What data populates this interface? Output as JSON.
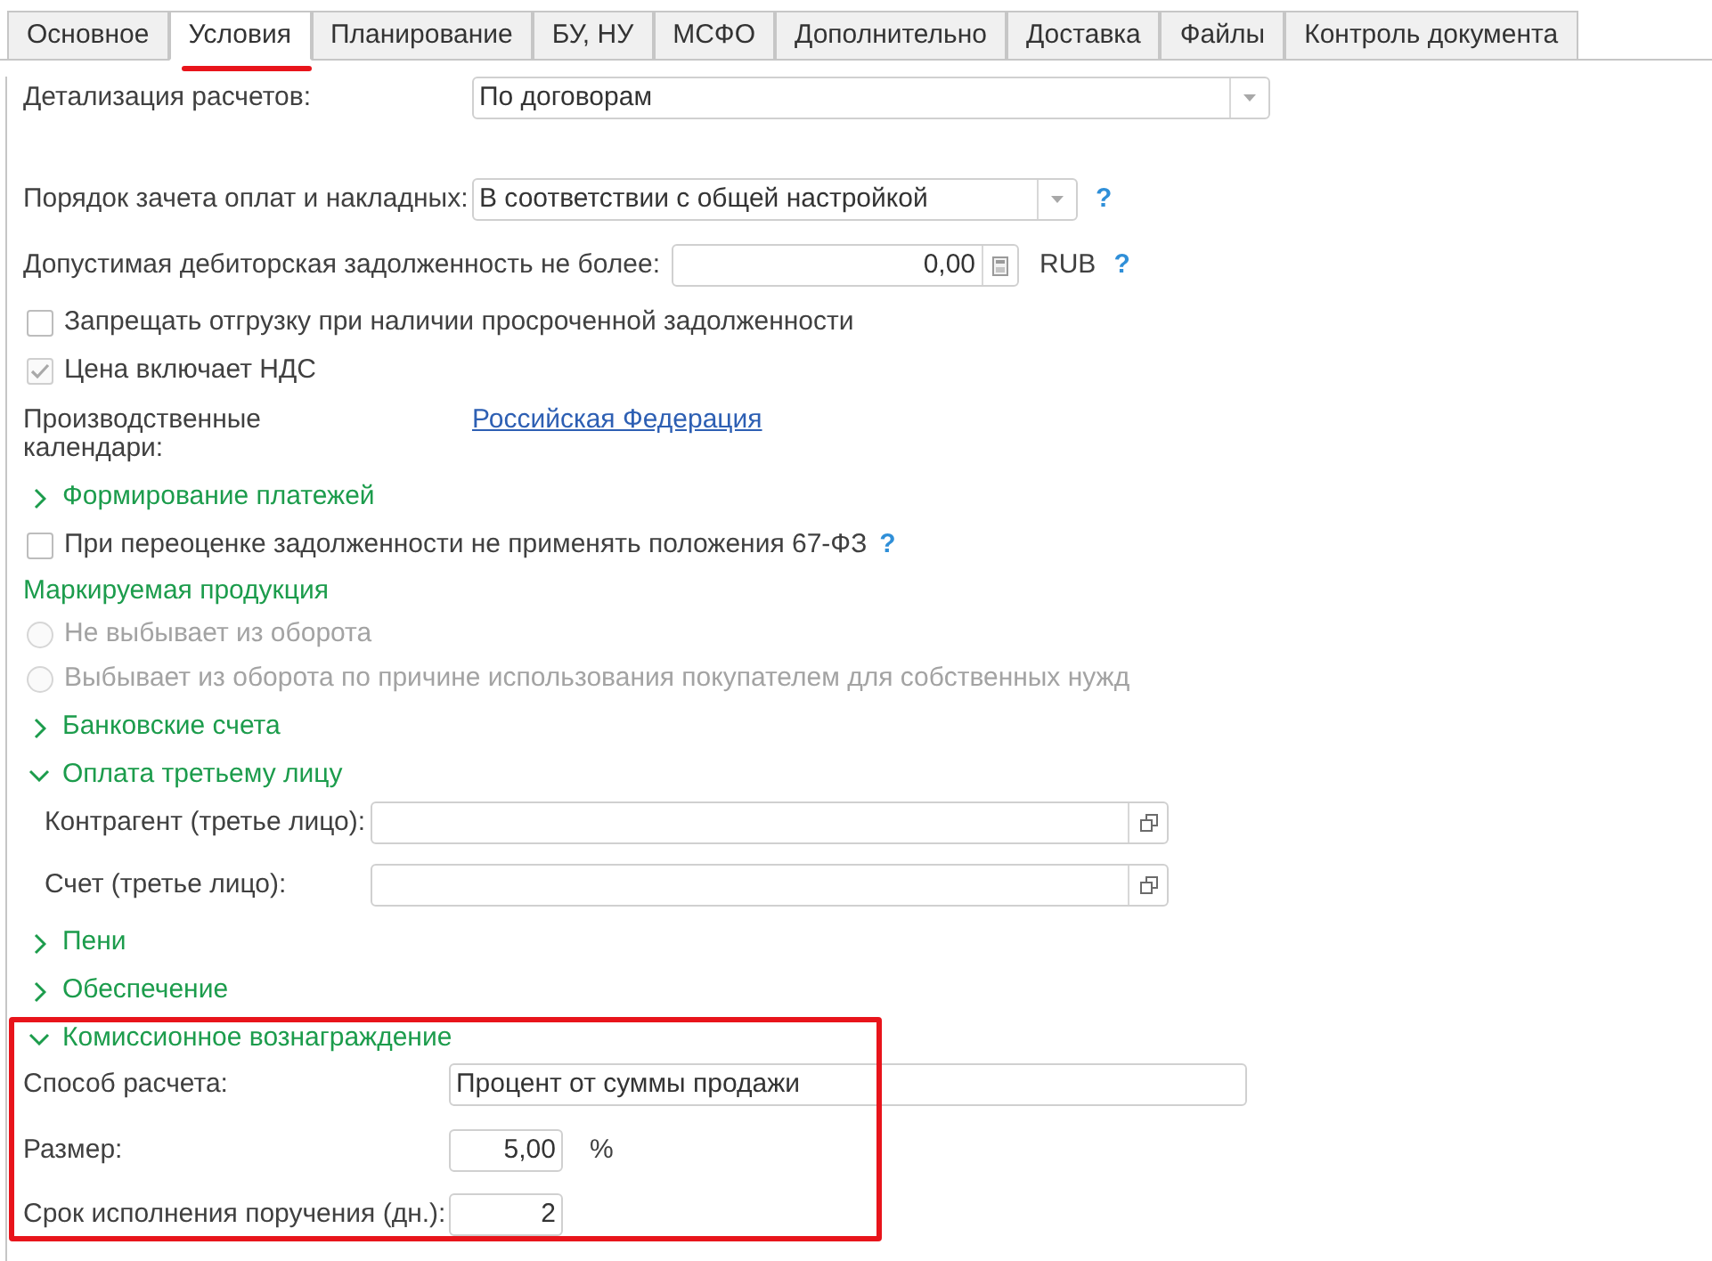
{
  "tabs": [
    {
      "label": "Основное",
      "selected": false,
      "annotated": false
    },
    {
      "label": "Условия",
      "selected": true,
      "annotated": true
    },
    {
      "label": "Планирование",
      "selected": false,
      "annotated": false
    },
    {
      "label": "БУ, НУ",
      "selected": false,
      "annotated": false
    },
    {
      "label": "МСФО",
      "selected": false,
      "annotated": false
    },
    {
      "label": "Дополнительно",
      "selected": false,
      "annotated": false
    },
    {
      "label": "Доставка",
      "selected": false,
      "annotated": false
    },
    {
      "label": "Файлы",
      "selected": false,
      "annotated": false
    },
    {
      "label": "Контроль документа",
      "selected": false,
      "annotated": false
    }
  ],
  "settlement_detail": {
    "label": "Детализация расчетов:",
    "value": "По договорам"
  },
  "offset_order": {
    "label": "Порядок зачета оплат и накладных:",
    "value": "В соответствии с общей настройкой",
    "help": "?"
  },
  "max_receivable": {
    "label": "Допустимая дебиторская задолженность не более:",
    "value": "0,00",
    "currency": "RUB",
    "help": "?"
  },
  "prohibit_shipment": {
    "label": "Запрещать отгрузку при наличии просроченной задолженности",
    "checked": false,
    "disabled": false
  },
  "price_includes_vat": {
    "label": "Цена включает НДС",
    "checked": true,
    "disabled": true
  },
  "calendars": {
    "label": "Производственные календари:",
    "link": "Российская Федерация"
  },
  "payment_forming": {
    "title": "Формирование платежей",
    "expanded": false
  },
  "revaluation": {
    "label": "При переоценке задолженности не применять положения 67-ФЗ",
    "checked": false,
    "disabled": false,
    "help": "?"
  },
  "marked_products": {
    "title": "Маркируемая продукция",
    "options": [
      {
        "label": "Не выбывает из оборота",
        "selected": false,
        "disabled": true
      },
      {
        "label": "Выбывает из оборота по причине использования покупателем для собственных нужд",
        "selected": false,
        "disabled": true
      }
    ]
  },
  "bank_accounts": {
    "title": "Банковские счета",
    "expanded": false
  },
  "third_party_payment": {
    "title": "Оплата третьему лицу",
    "expanded": true,
    "fields": [
      {
        "label": "Контрагент (третье лицо):"
      },
      {
        "label": "Счет (третье лицо):"
      }
    ]
  },
  "penalties": {
    "title": "Пени",
    "expanded": false
  },
  "security": {
    "title": "Обеспечение",
    "expanded": false
  },
  "commission": {
    "title": "Комиссионное вознаграждение",
    "expanded": true,
    "highlighted": true,
    "method": {
      "label": "Способ расчета:",
      "value": "Процент от суммы продажи"
    },
    "size": {
      "label": "Размер:",
      "value": "5,00",
      "unit": "%"
    },
    "term": {
      "label": "Срок исполнения поручения (дн.):",
      "value": "2"
    }
  }
}
